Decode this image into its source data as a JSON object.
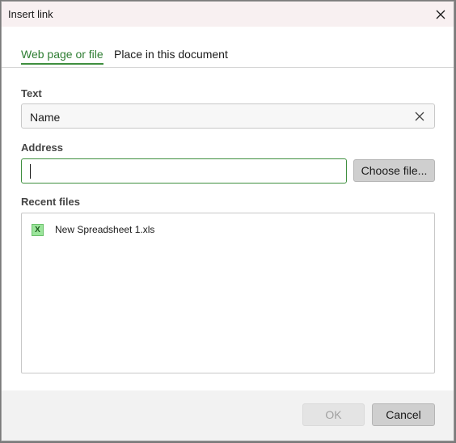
{
  "dialog": {
    "title": "Insert link",
    "close_icon": "close-icon"
  },
  "tabs": [
    {
      "label": "Web page or file",
      "active": true
    },
    {
      "label": "Place in this document",
      "active": false
    }
  ],
  "text_field": {
    "label": "Text",
    "value": "Name",
    "clear_icon": "clear-icon"
  },
  "address_field": {
    "label": "Address",
    "value": ""
  },
  "choose_file_label": "Choose file...",
  "recent_files": {
    "label": "Recent files",
    "items": [
      {
        "name": "New Spreadsheet 1.xls",
        "icon": "spreadsheet-icon",
        "icon_glyph": "X"
      }
    ]
  },
  "buttons": {
    "ok_label": "OK",
    "cancel_label": "Cancel"
  },
  "colors": {
    "accent": "#3f8f3f",
    "title_bar": "#f8f0f1"
  }
}
